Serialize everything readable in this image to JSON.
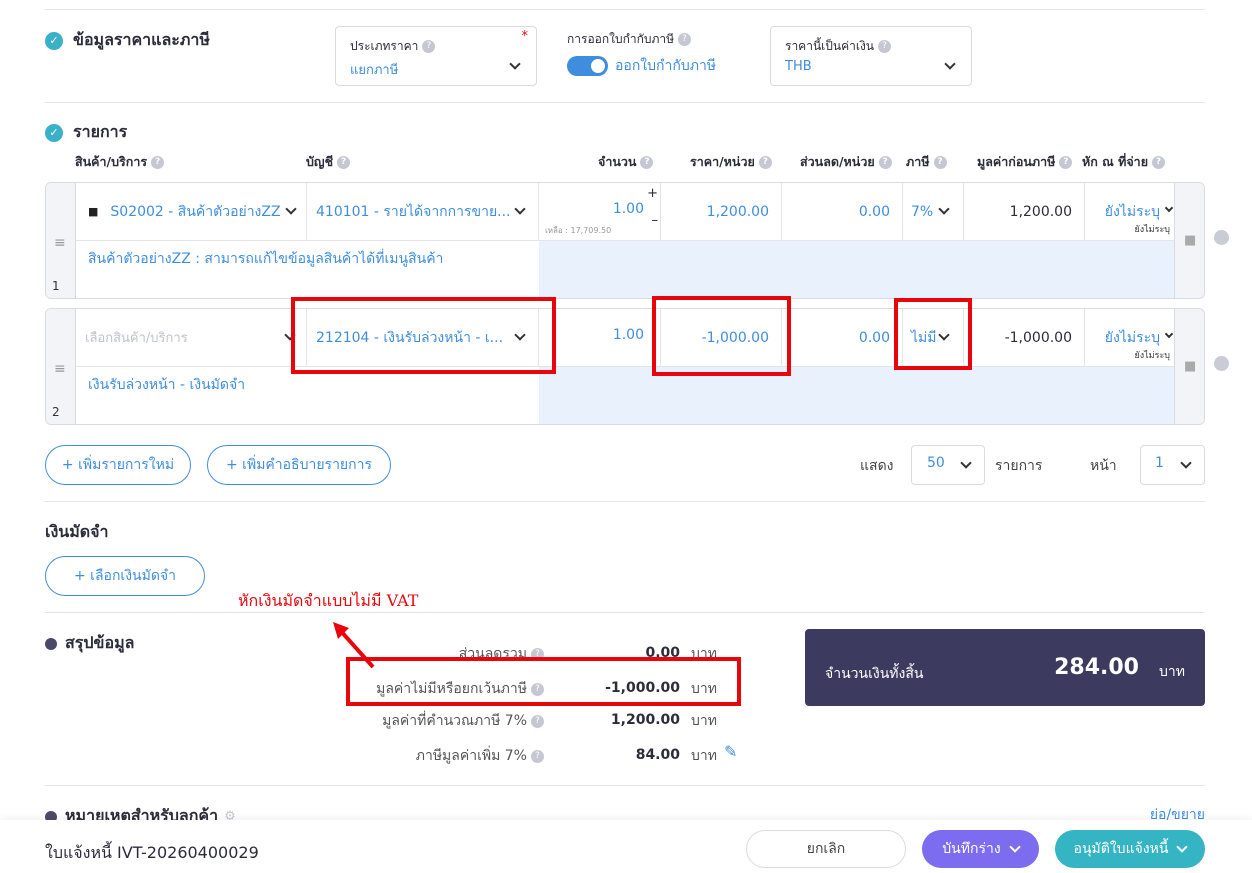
{
  "price_tax": {
    "title": "ข้อมูลราคาและภาษี",
    "price_type_label": "ประเภทราคา",
    "price_type_value": "แยกภาษี",
    "required_mark": "*",
    "tax_invoice_label": "การออกใบกำกับภาษี",
    "tax_invoice_toggle_label": "ออกใบกำกับภาษี",
    "tax_invoice_on": true,
    "currency_label": "ราคานี้เป็นค่าเงิน",
    "currency_value": "THB"
  },
  "items": {
    "title": "รายการ",
    "columns": {
      "product": "สินค้า/บริการ",
      "account": "บัญชี",
      "qty": "จำนวน",
      "price": "ราคา/หน่วย",
      "discount": "ส่วนลด/หน่วย",
      "tax": "ภาษี",
      "pretax": "มูลค่าก่อนภาษี",
      "withholding": "หัก ณ ที่จ่าย"
    },
    "rows": [
      {
        "index": "1",
        "product": "S02002 - สินค้าตัวอย่างZZ",
        "account": "410101 - รายได้จากการขาย...",
        "qty": "1.00",
        "remaining": "เหลือ : 17,709.50",
        "price": "1,200.00",
        "discount": "0.00",
        "tax": "7%",
        "pretax": "1,200.00",
        "withholding": "ยังไม่ระบุ",
        "withholding_sub": "ยังไม่ระบุ",
        "description": "สินค้าตัวอย่างZZ : สามารถแก้ไขข้อมูลสินค้าได้ที่เมนูสินค้า"
      },
      {
        "index": "2",
        "product_placeholder": "เลือกสินค้า/บริการ",
        "account": "212104 - เงินรับล่วงหน้า - เ...",
        "qty": "1.00",
        "price": "-1,000.00",
        "discount": "0.00",
        "tax": "ไม่มี",
        "pretax": "-1,000.00",
        "withholding": "ยังไม่ระบุ",
        "withholding_sub": "ยังไม่ระบุ",
        "description": "เงินรับล่วงหน้า - เงินมัดจำ"
      }
    ],
    "add_item_label": "+ เพิ่มรายการใหม่",
    "add_desc_label": "+ เพิ่มคำอธิบายรายการ",
    "show_label": "แสดง",
    "per_page": "50",
    "items_label": "รายการ",
    "page_label": "หน้า",
    "page": "1"
  },
  "deposit": {
    "title": "เงินมัดจำ",
    "select_label": "+ เลือกเงินมัดจำ",
    "annotation": "หักเงินมัดจำแบบไม่มี VAT"
  },
  "summary": {
    "title": "สรุปข้อมูล",
    "rows": [
      {
        "label": "ส่วนลดรวม",
        "value": "0.00",
        "unit": "บาท"
      },
      {
        "label": "มูลค่าไม่มีหรือยกเว้นภาษี",
        "value": "-1,000.00",
        "unit": "บาท"
      },
      {
        "label": "มูลค่าที่คำนวณภาษี 7%",
        "value": "1,200.00",
        "unit": "บาท"
      },
      {
        "label": "ภาษีมูลค่าเพิ่ม 7%",
        "value": "84.00",
        "unit": "บาท"
      }
    ],
    "total_label": "จำนวนเงินทั้งสิ้น",
    "total_value": "284.00",
    "total_unit": "บาท"
  },
  "notes": {
    "title": "หมายเหตุสำหรับลูกค้า",
    "toggle_label": "ย่อ/ขยาย"
  },
  "footer": {
    "doc_title": "ใบแจ้งหนี้ IVT-20260400029",
    "cancel_label": "ยกเลิก",
    "save_label": "บันทึกร่าง",
    "approve_label": "อนุมัติใบแจ้งหนี้"
  },
  "colors": {
    "accent": "#3f8ede",
    "check": "#3bb0c9",
    "highlight_red": "#e8060c",
    "total_bg": "#3c3a5e",
    "save_btn": "#7b6cf0",
    "approve_btn": "#35b4c4"
  }
}
